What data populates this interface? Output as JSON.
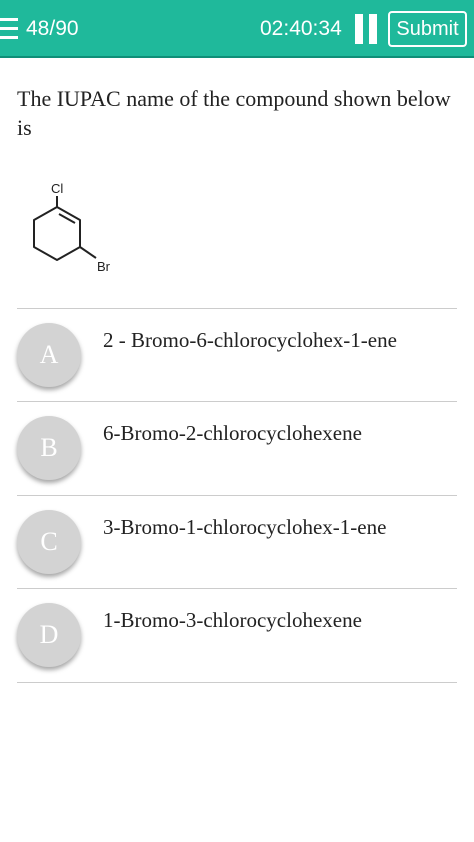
{
  "header": {
    "progress": "48/90",
    "timer": "02:40:34",
    "submit_label": "Submit",
    "colors": {
      "bar": "#1fb99b",
      "text": "#ffffff"
    }
  },
  "question": {
    "text": "The IUPAC name of the compound shown below is",
    "structure": {
      "label_top": "Cl",
      "label_right": "Br"
    }
  },
  "options": [
    {
      "letter": "A",
      "text": "2 - Bromo-6-chlorocyclohex-1-ene"
    },
    {
      "letter": "B",
      "text": "6-Bromo-2-chlorocyclohexene"
    },
    {
      "letter": "C",
      "text": "3-Bromo-1-chlorocyclohex-1-ene"
    },
    {
      "letter": "D",
      "text": "1-Bromo-3-chlorocyclohexene"
    }
  ]
}
